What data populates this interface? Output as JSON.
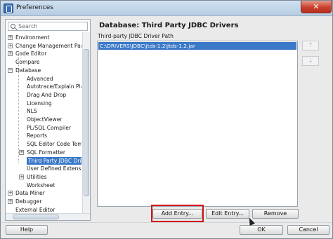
{
  "window": {
    "title": "Preferences",
    "close_label": "✕"
  },
  "sidebar": {
    "search_placeholder": "Search",
    "tree": [
      {
        "label": "Environment",
        "level": 0,
        "expander": "+"
      },
      {
        "label": "Change Management Parar",
        "level": 0,
        "expander": "+"
      },
      {
        "label": "Code Editor",
        "level": 0,
        "expander": "+"
      },
      {
        "label": "Compare",
        "level": 0,
        "expander": ""
      },
      {
        "label": "Database",
        "level": 0,
        "expander": "−"
      },
      {
        "label": "Advanced",
        "level": 1,
        "expander": ""
      },
      {
        "label": "Autotrace/Explain Plan",
        "level": 1,
        "expander": ""
      },
      {
        "label": "Drag And Drop",
        "level": 1,
        "expander": ""
      },
      {
        "label": "Licensing",
        "level": 1,
        "expander": ""
      },
      {
        "label": "NLS",
        "level": 1,
        "expander": ""
      },
      {
        "label": "ObjectViewer",
        "level": 1,
        "expander": ""
      },
      {
        "label": "PL/SQL Compiler",
        "level": 1,
        "expander": ""
      },
      {
        "label": "Reports",
        "level": 1,
        "expander": ""
      },
      {
        "label": "SQL Editor Code Templa",
        "level": 1,
        "expander": ""
      },
      {
        "label": "SQL Formatter",
        "level": 1,
        "expander": "+"
      },
      {
        "label": "Third Party JDBC Drivers",
        "level": 1,
        "expander": "",
        "selected": true
      },
      {
        "label": "User Defined Extension",
        "level": 1,
        "expander": ""
      },
      {
        "label": "Utilities",
        "level": 1,
        "expander": "+"
      },
      {
        "label": "Worksheet",
        "level": 1,
        "expander": ""
      },
      {
        "label": "Data Miner",
        "level": 0,
        "expander": "+"
      },
      {
        "label": "Debugger",
        "level": 0,
        "expander": "+"
      },
      {
        "label": "External Editor",
        "level": 0,
        "expander": ""
      }
    ]
  },
  "main": {
    "section_title": "Database: Third Party JDBC Drivers",
    "path_label": "Third-party JDBC Driver Path",
    "paths": [
      "C:\\DRIVERS\\JDBC\\jtds-1.2\\jtds-1.2.jar"
    ],
    "move_up_label": "⇡",
    "move_down_label": "⇣",
    "add_entry_label": "Add Entry...",
    "edit_entry_label": "Edit Entry...",
    "remove_label": "Remove",
    "highlight_color": "#d4151a"
  },
  "footer": {
    "help_label": "Help",
    "ok_label": "OK",
    "cancel_label": "Cancel"
  },
  "colors": {
    "selection": "#3a78c8",
    "titlebar": "#c3d7eb"
  }
}
